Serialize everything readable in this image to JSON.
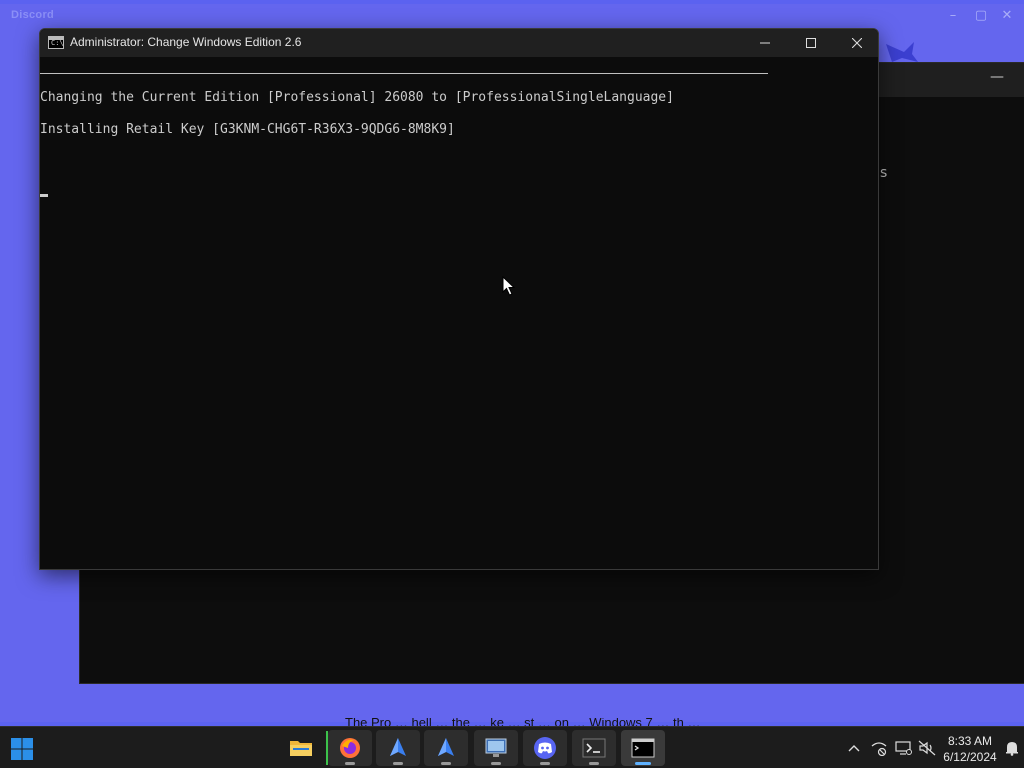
{
  "background_window": {
    "app_title": "Discord",
    "text_fragment": "s",
    "bottom_caption": "The Pro …  hell … the  … ke … st … on … Windows 7  … th …"
  },
  "console": {
    "title": "Administrator:  Change Windows Edition 2.6",
    "lines": [
      "Changing the Current Edition [Professional] 26080 to [ProfessionalSingleLanguage]",
      "Installing Retail Key [G3KNM-CHG6T-R36X3-9QDG6-8M8K9]"
    ],
    "icon_glyph": "C:\\",
    "controls": {
      "minimize": "minimize-icon",
      "maximize": "maximize-icon",
      "close": "close-icon"
    }
  },
  "taskbar": {
    "apps": [
      {
        "name": "file-explorer",
        "icon": "folder-icon"
      },
      {
        "name": "firefox",
        "icon": "firefox-icon"
      },
      {
        "name": "app-blue-1",
        "icon": "blue-app-icon"
      },
      {
        "name": "app-blue-2",
        "icon": "blue-app-icon"
      },
      {
        "name": "monitor-app",
        "icon": "monitor-icon"
      },
      {
        "name": "discord",
        "icon": "discord-icon"
      },
      {
        "name": "terminal",
        "icon": "terminal-icon"
      },
      {
        "name": "command-prompt",
        "icon": "cmd-icon"
      }
    ],
    "clock": {
      "time": "8:33 AM",
      "date": "6/12/2024"
    }
  },
  "colors": {
    "desktop": "#5b62f0",
    "console_bg": "#0c0c0c",
    "titlebar": "#202020",
    "taskbar": "#1c1c1c",
    "discord_blurple": "#5865f2"
  }
}
